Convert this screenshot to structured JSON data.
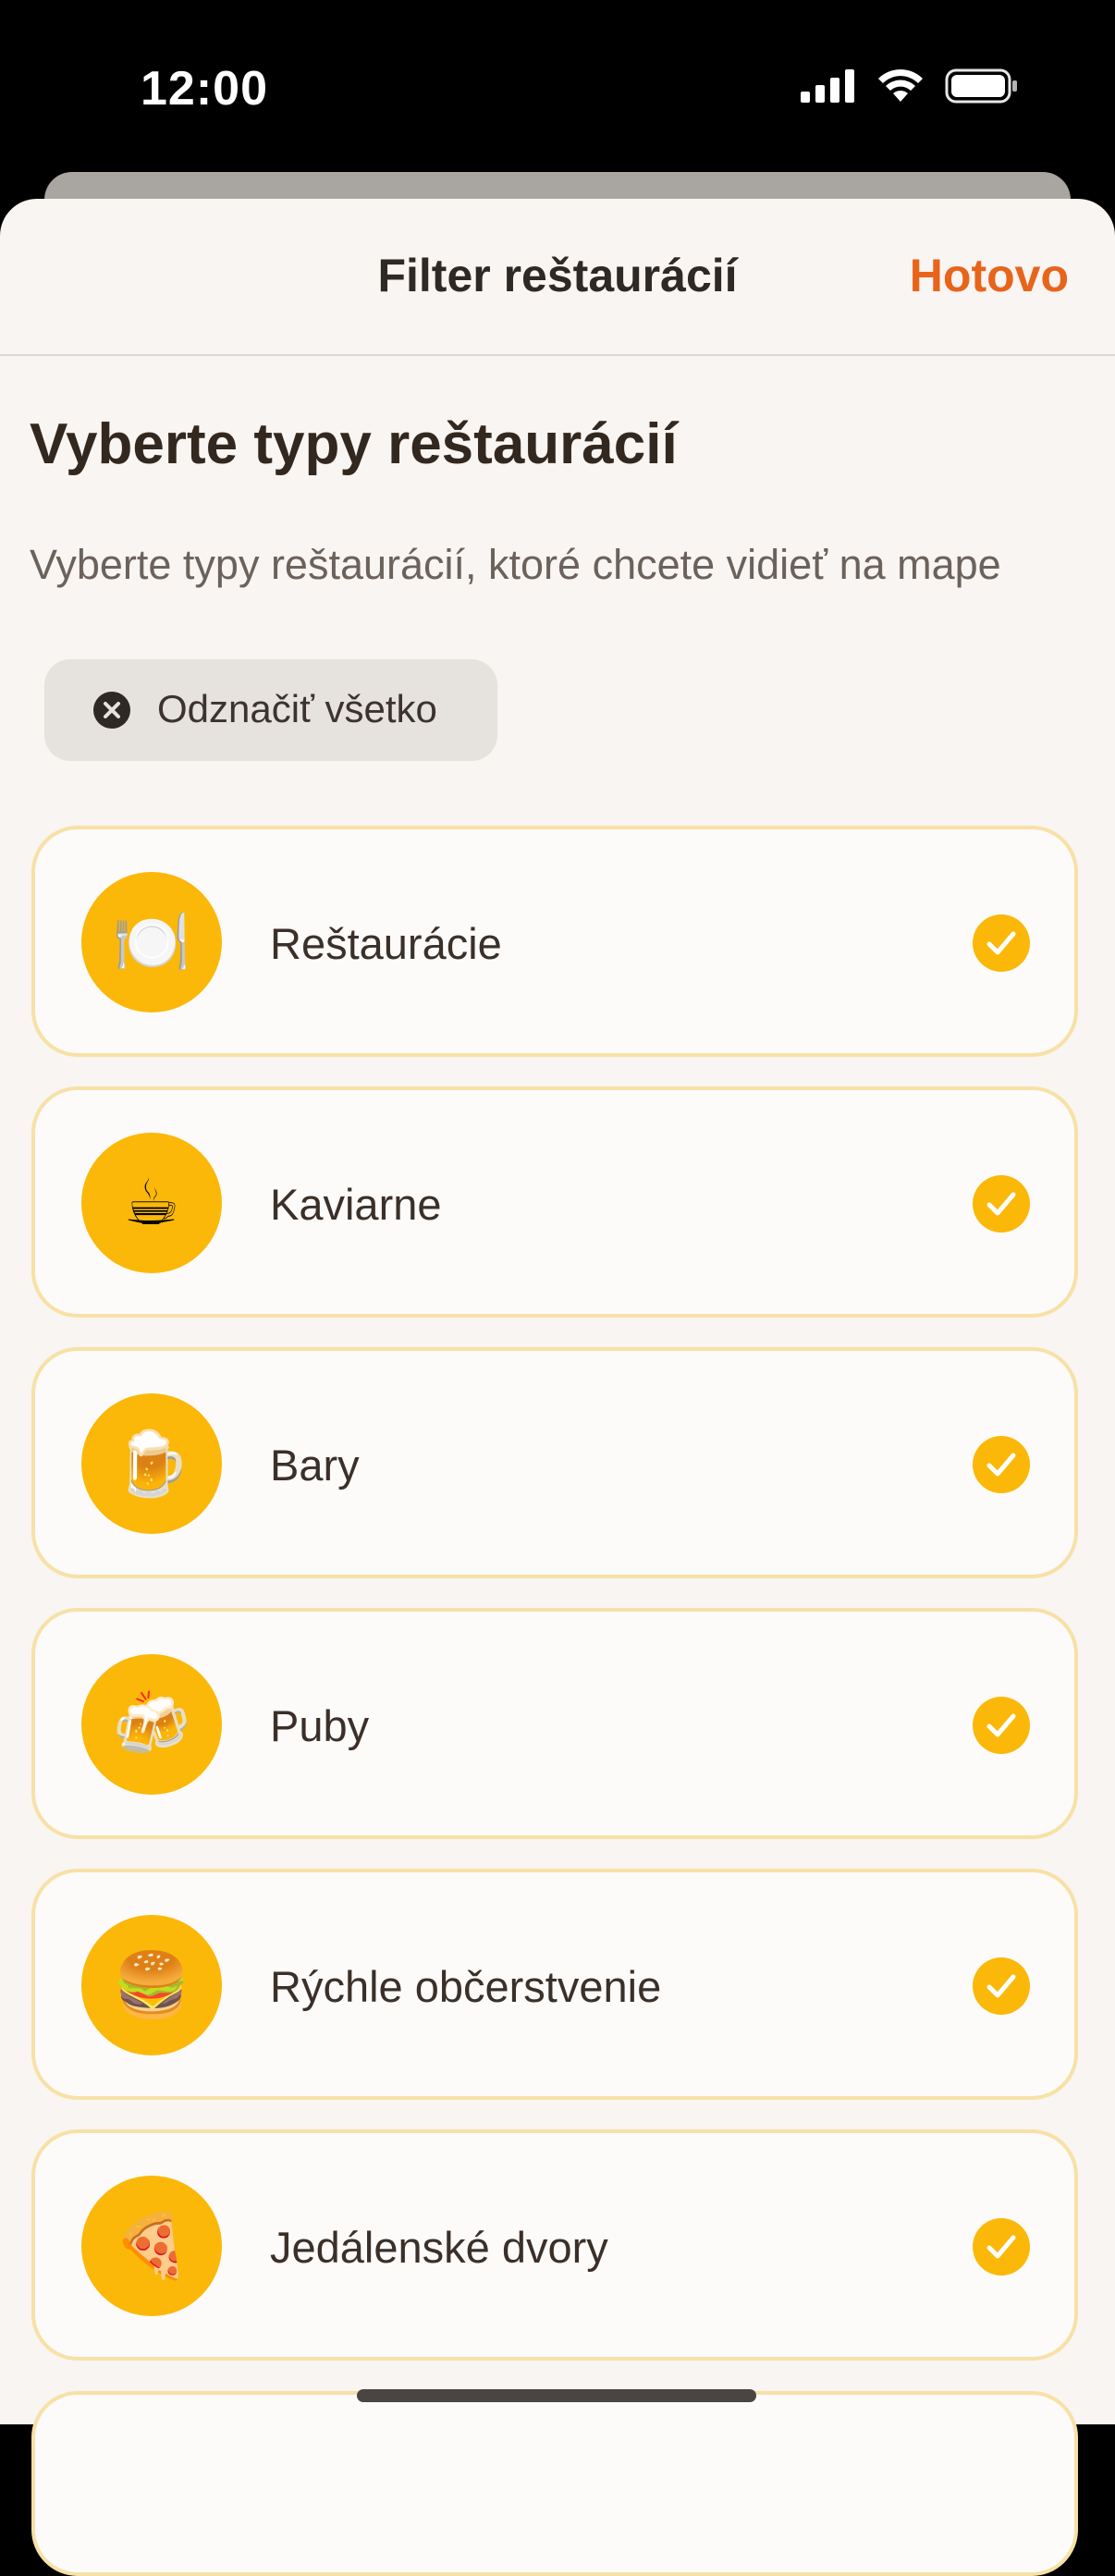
{
  "status_bar": {
    "time": "12:00"
  },
  "nav": {
    "title": "Filter reštaurácií",
    "done_label": "Hotovo"
  },
  "content": {
    "heading": "Vyberte typy reštaurácií",
    "subtitle": "Vyberte typy reštaurácií, ktoré chcete vidieť na mape",
    "deselect_all_label": "Odznačiť všetko"
  },
  "categories": [
    {
      "label": "Reštaurácie",
      "icon": "plate-with-cutlery-icon",
      "emoji": "🍽️",
      "selected": true
    },
    {
      "label": "Kaviarne",
      "icon": "hot-beverage-icon",
      "emoji": "☕",
      "selected": true
    },
    {
      "label": "Bary",
      "icon": "beer-mug-icon",
      "emoji": "🍺",
      "selected": true
    },
    {
      "label": "Puby",
      "icon": "clinking-beer-mugs-icon",
      "emoji": "🍻",
      "selected": true
    },
    {
      "label": "Rýchle občerstvenie",
      "icon": "hamburger-icon",
      "emoji": "🍔",
      "selected": true
    },
    {
      "label": "Jedálenské dvory",
      "icon": "pizza-icon",
      "emoji": "🍕",
      "selected": true
    }
  ],
  "colors": {
    "accent": "#e8641b",
    "icon_background": "#fbb808",
    "card_border": "#f7e1a6",
    "sheet_background": "#f8f5f2"
  }
}
